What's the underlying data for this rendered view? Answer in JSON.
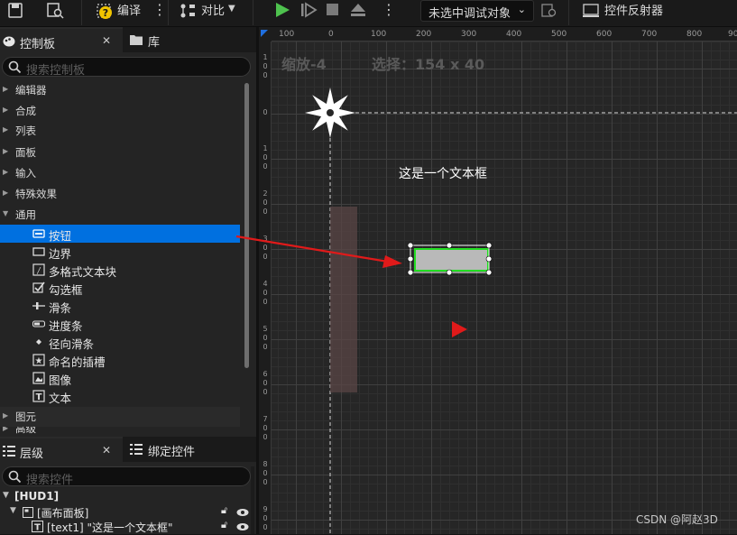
{
  "toolbar": {
    "compile_label": "编译",
    "diff_label": "对比",
    "debug_object_label": "未选中调试对象",
    "widget_reflector_label": "控件反射器"
  },
  "palette": {
    "tab_palette": "控制板",
    "tab_library": "库",
    "search_placeholder": "搜索控制板",
    "categories": [
      "编辑器",
      "合成",
      "列表",
      "面板",
      "输入",
      "特殊效果",
      "通用"
    ],
    "common_items": [
      "按钮",
      "边界",
      "多格式文本块",
      "勾选框",
      "滑条",
      "进度条",
      "径向滑条",
      "命名的插槽",
      "图像",
      "文本"
    ],
    "category_after": "图元",
    "category_cut": "高级"
  },
  "hierarchy": {
    "tab_hierarchy": "层级",
    "tab_bind_widgets": "绑定控件",
    "search_placeholder": "搜索控件",
    "root": "[HUD1]",
    "canvas_panel": "[画布面板]",
    "text_widget": "[text1] \"这是一个文本框\""
  },
  "canvas": {
    "zoom_label": "缩放-4",
    "selection_label": "选择：154 x 40",
    "ruler_top_ticks": [
      "100",
      "0",
      "100",
      "200",
      "300",
      "400",
      "500",
      "600",
      "700",
      "800",
      "90"
    ],
    "ruler_left_ticks": [
      "1\n0\n0",
      "0",
      "1\n0\n0",
      "2\n0\n0",
      "3\n0\n0",
      "4\n0\n0",
      "5\n0\n0",
      "6\n0\n0",
      "7\n0\n0",
      "8\n0\n0",
      "9\n0\n0"
    ],
    "text_widget_content": "这是一个文本框",
    "watermark": "CSDN @阿赵3D"
  },
  "colors": {
    "selection_blue": "#0070e0",
    "selection_outline_green": "#22dd22",
    "annotation_red": "#e01a1a",
    "play_green": "#4ec24e"
  }
}
